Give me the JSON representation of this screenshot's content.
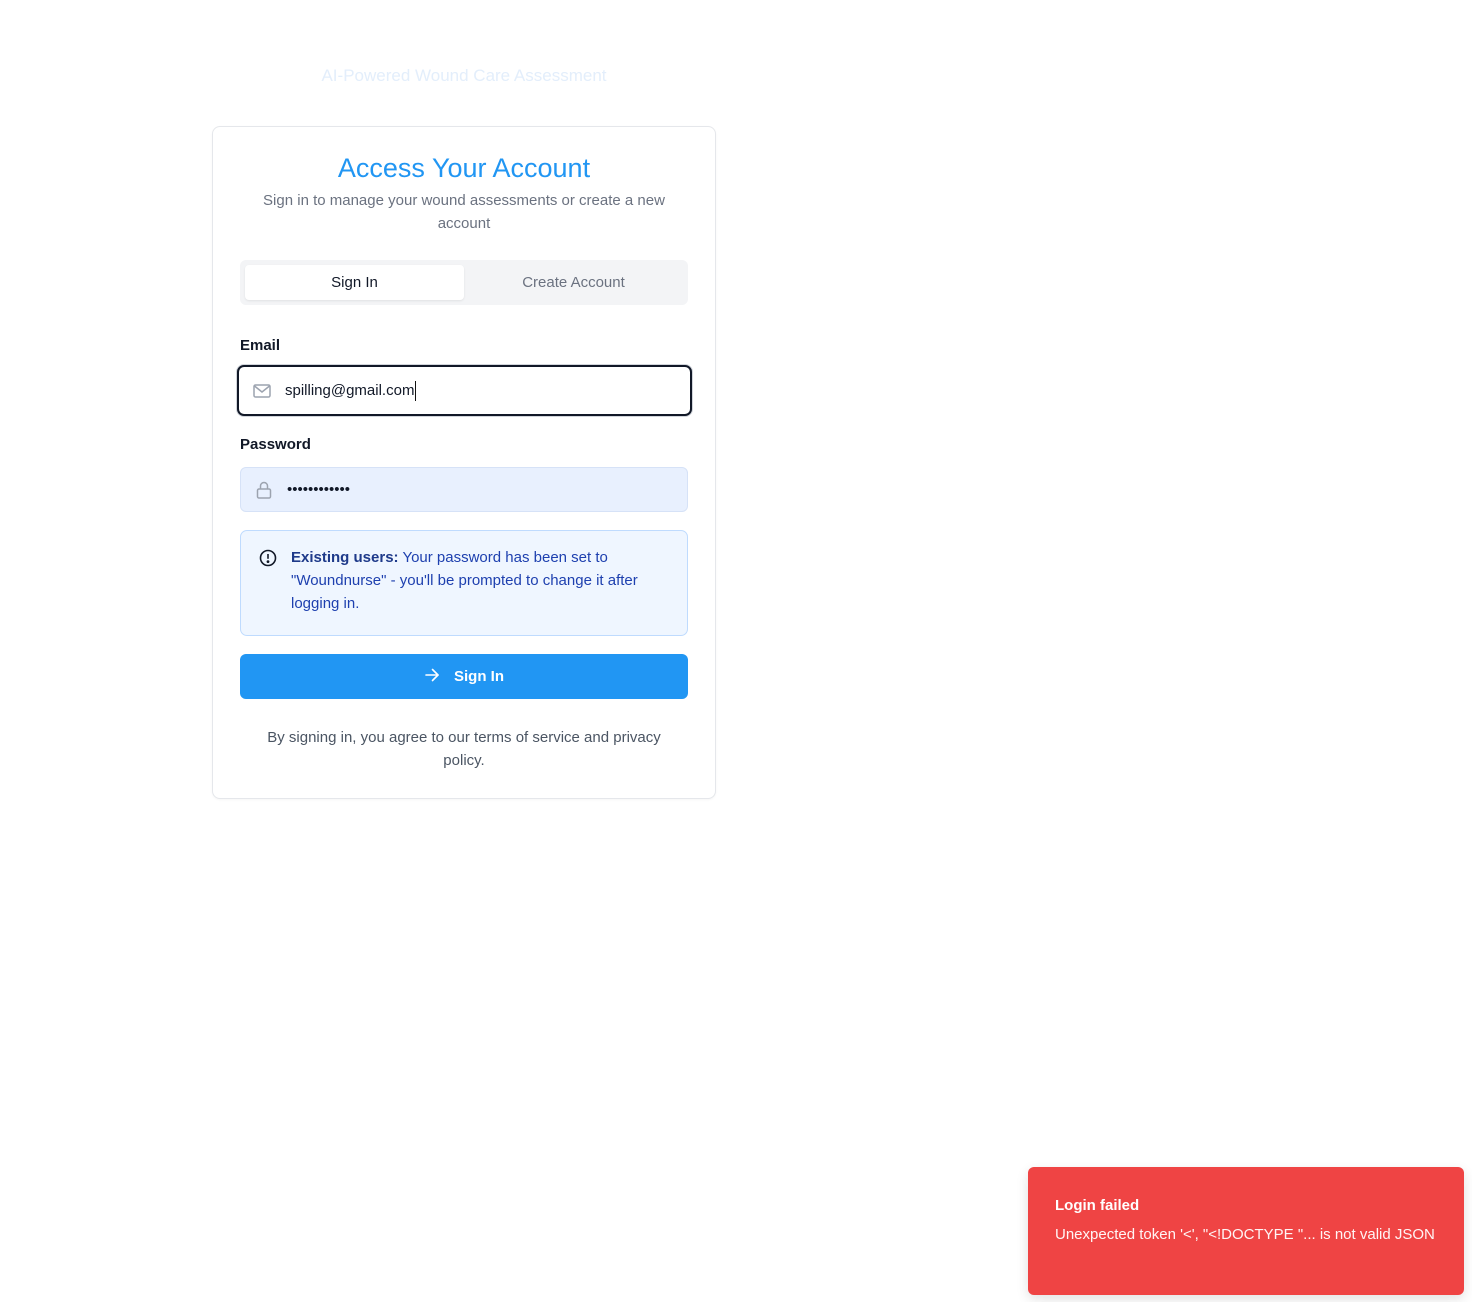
{
  "header": {
    "subtitle": "AI-Powered Wound Care Assessment"
  },
  "card": {
    "title": "Access Your Account",
    "description": "Sign in to manage your wound assessments or create a new account"
  },
  "tabs": [
    {
      "label": "Sign In",
      "active": true
    },
    {
      "label": "Create Account",
      "active": false
    }
  ],
  "form": {
    "email_label": "Email",
    "email_value": "spilling@gmail.com",
    "email_icon": "mail-icon",
    "password_label": "Password",
    "password_value": "••••••••••••",
    "password_icon": "lock-icon"
  },
  "notice": {
    "bold": "Existing users:",
    "text": " Your password has been set to \"Woundnurse\" - you'll be prompted to change it after logging in.",
    "icon": "alert-circle-icon"
  },
  "submit": {
    "label": "Sign In",
    "icon": "arrow-right-icon"
  },
  "terms": "By signing in, you agree to our terms of service and privacy policy.",
  "toast": {
    "title": "Login failed",
    "message": "Unexpected token '<', \"<!DOCTYPE \"... is not valid JSON"
  },
  "colors": {
    "accent": "#2196f3",
    "error": "#ef4444",
    "notice_bg": "#eff6ff",
    "notice_text": "#1e40af"
  }
}
